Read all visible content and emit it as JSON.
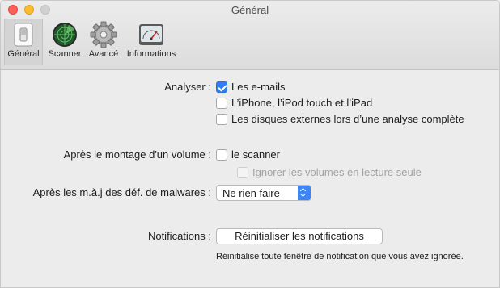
{
  "window": {
    "title": "Général"
  },
  "toolbar": {
    "items": [
      {
        "label": "Général",
        "icon": "switch-icon",
        "selected": true
      },
      {
        "label": "Scanner",
        "icon": "radar-icon",
        "selected": false
      },
      {
        "label": "Avancé",
        "icon": "gear-icon",
        "selected": false
      },
      {
        "label": "Informations",
        "icon": "gauge-icon",
        "selected": false
      }
    ]
  },
  "analyser": {
    "label": "Analyser :",
    "options": [
      {
        "label": "Les e-mails",
        "checked": true
      },
      {
        "label": "L’iPhone, l’iPod touch et l’iPad",
        "checked": false
      },
      {
        "label": "Les disques externes lors d’une analyse complète",
        "checked": false
      }
    ]
  },
  "mount": {
    "label": "Après le montage d'un volume :",
    "option_scanner": {
      "label": "le scanner",
      "checked": false
    },
    "option_readonly": {
      "label": "Ignorer les volumes en lecture seule",
      "checked": false,
      "disabled": true
    }
  },
  "malware_update": {
    "label": "Après les m.à.j des déf. de malwares :",
    "selected": "Ne rien faire"
  },
  "notifications": {
    "label": "Notifications :",
    "button_label": "Réinitialiser les notifications",
    "help": "Réinitialise toute fenêtre de notification que vous avez ignorée."
  },
  "colors": {
    "accent": "#2f7df6",
    "close": "#fc5f57",
    "minimize": "#fdbc2e"
  }
}
